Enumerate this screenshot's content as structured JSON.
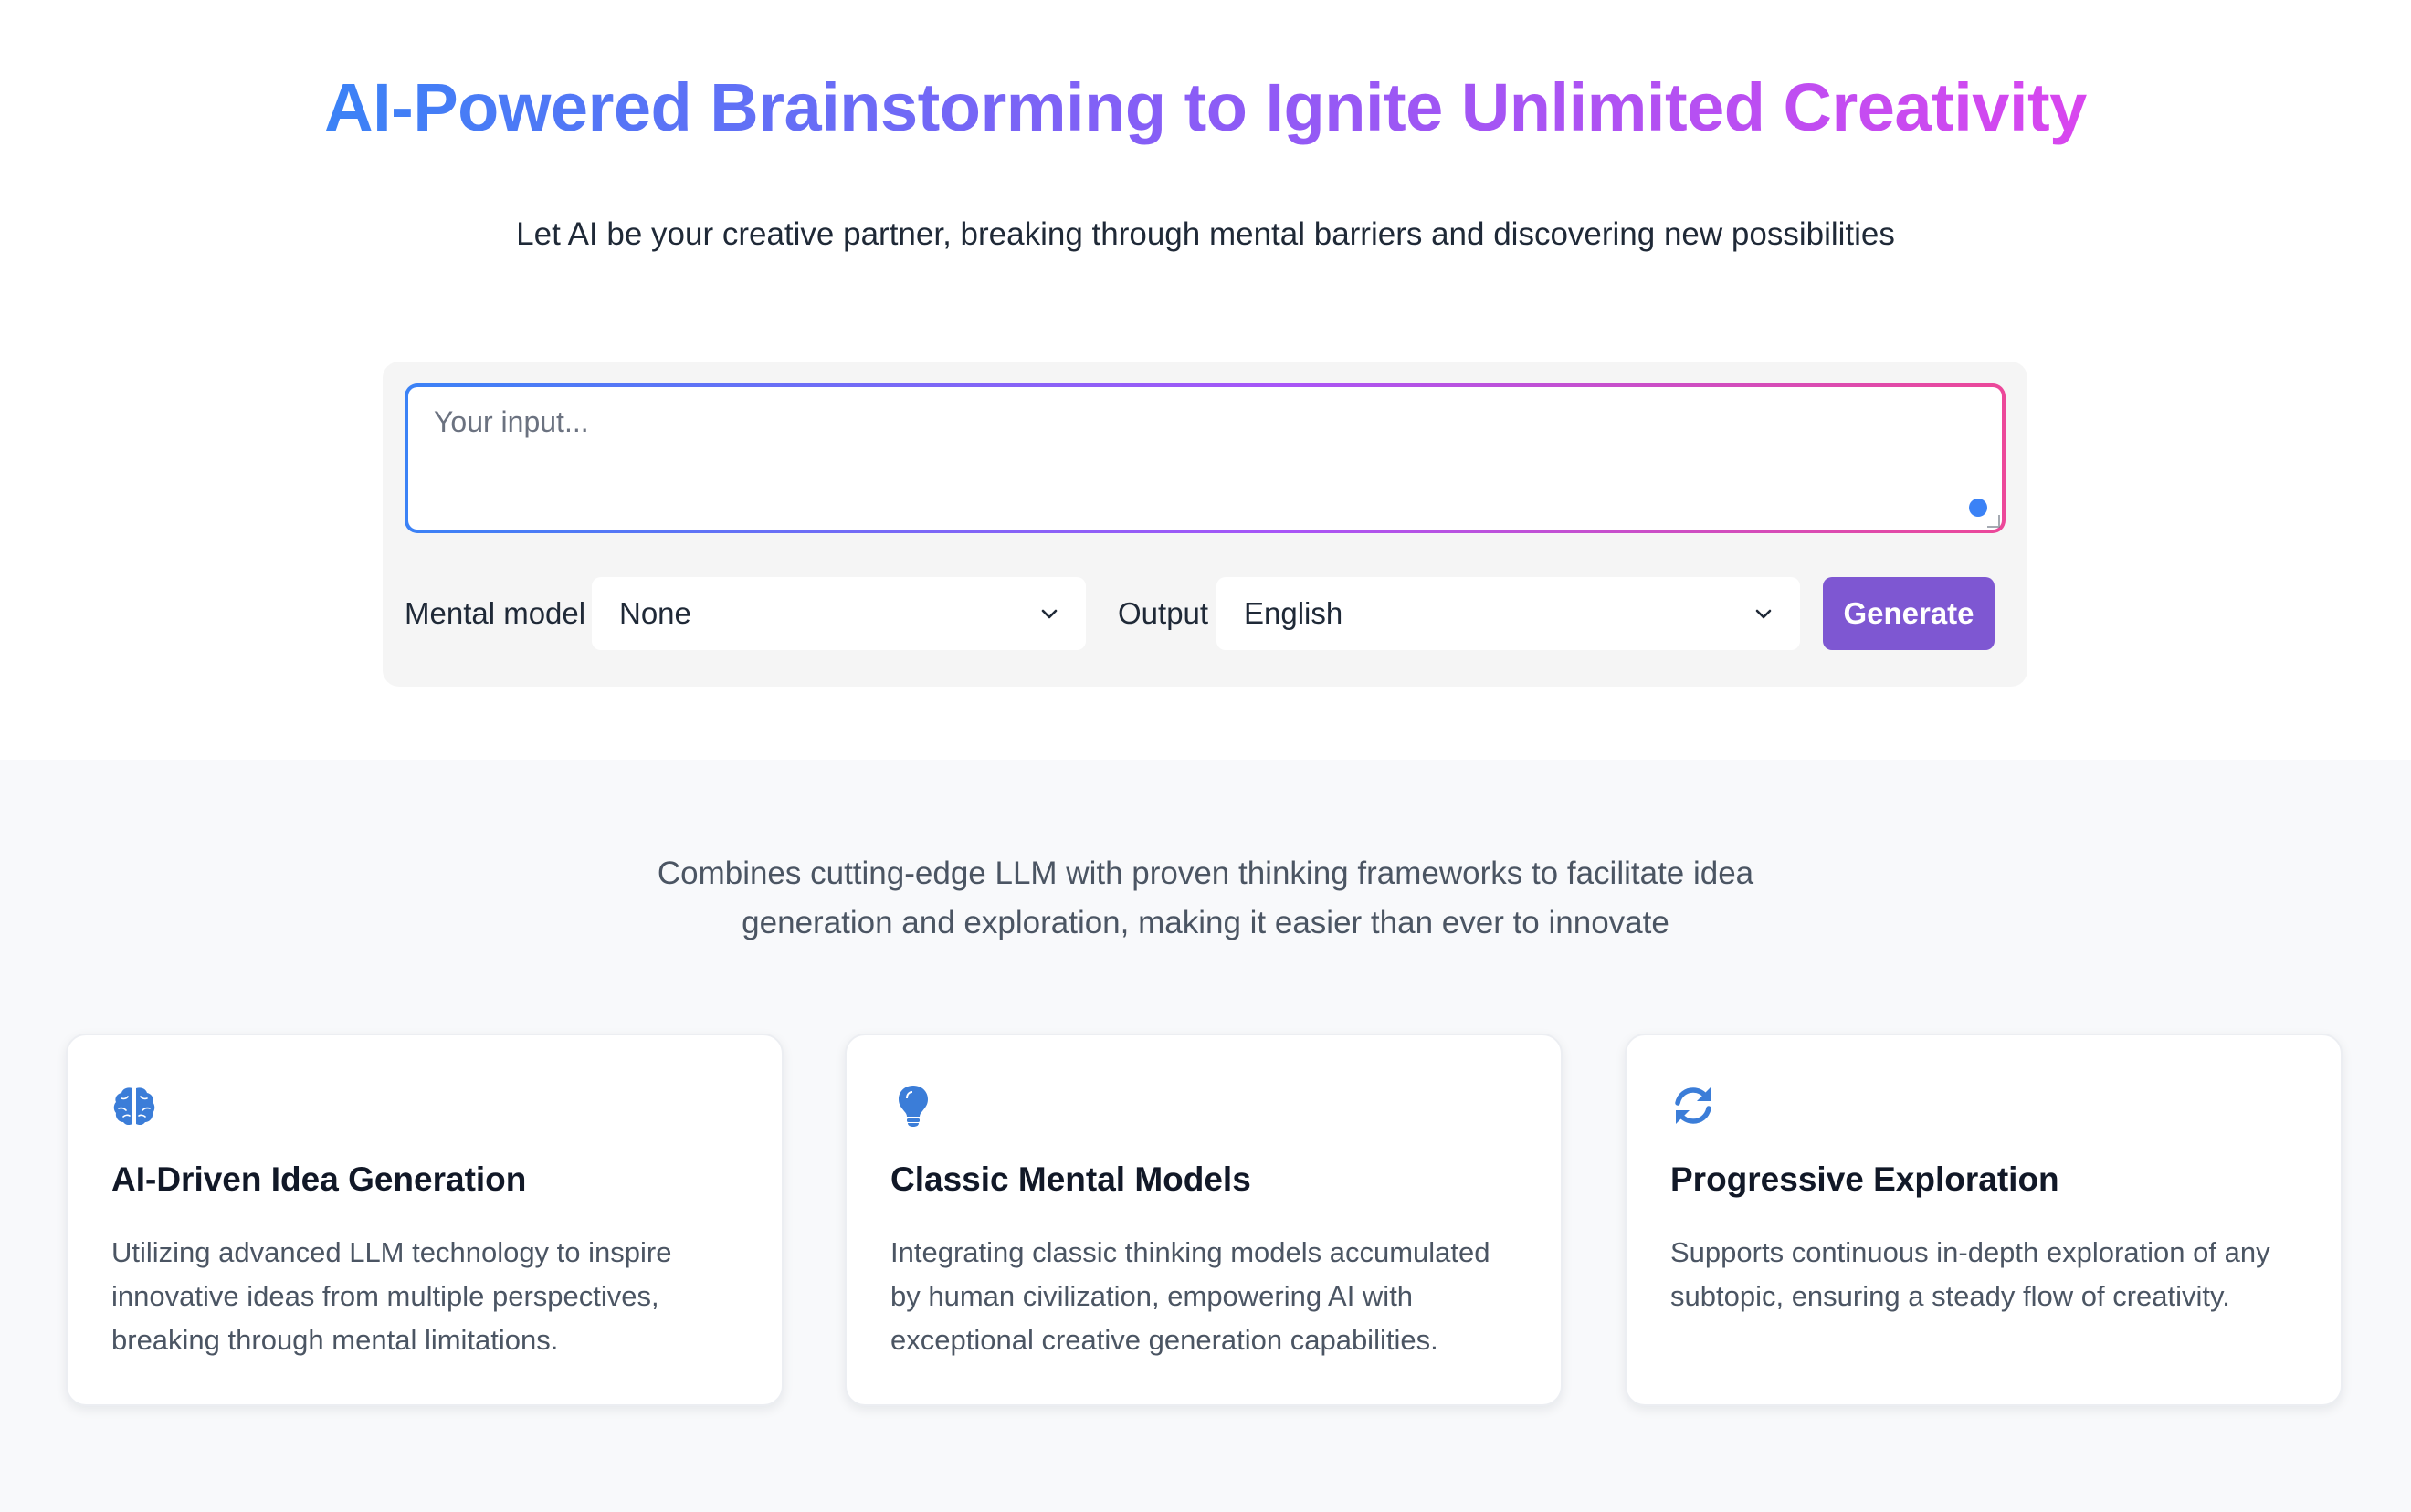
{
  "hero": {
    "title": "AI-Powered Brainstorming to Ignite Unlimited Creativity",
    "subtitle": "Let AI be your creative partner, breaking through mental barriers and discovering new possibilities"
  },
  "form": {
    "input_placeholder": "Your input...",
    "input_value": "",
    "mental_model_label": "Mental model",
    "mental_model_value": "None",
    "output_label": "Output",
    "output_value": "English",
    "generate_label": "Generate"
  },
  "features": {
    "description": "Combines cutting-edge LLM with proven thinking frameworks to facilitate idea generation and exploration, making it easier than ever to innovate",
    "cards": [
      {
        "icon": "brain-icon",
        "title": "AI-Driven Idea Generation",
        "text": "Utilizing advanced LLM technology to inspire innovative ideas from multiple perspectives, breaking through mental limitations."
      },
      {
        "icon": "lightbulb-icon",
        "title": "Classic Mental Models",
        "text": "Integrating classic thinking models accumulated by human civilization, empowering AI with exceptional creative generation capabilities."
      },
      {
        "icon": "refresh-icon",
        "title": "Progressive Exploration",
        "text": "Supports continuous in-depth exploration of any subtopic, ensuring a steady flow of creativity."
      }
    ]
  },
  "colors": {
    "gradient_start": "#3b82f6",
    "gradient_mid": "#8b5cf6",
    "gradient_end": "#d946ef",
    "button": "#7e57d2",
    "icon": "#3b7dd8"
  }
}
